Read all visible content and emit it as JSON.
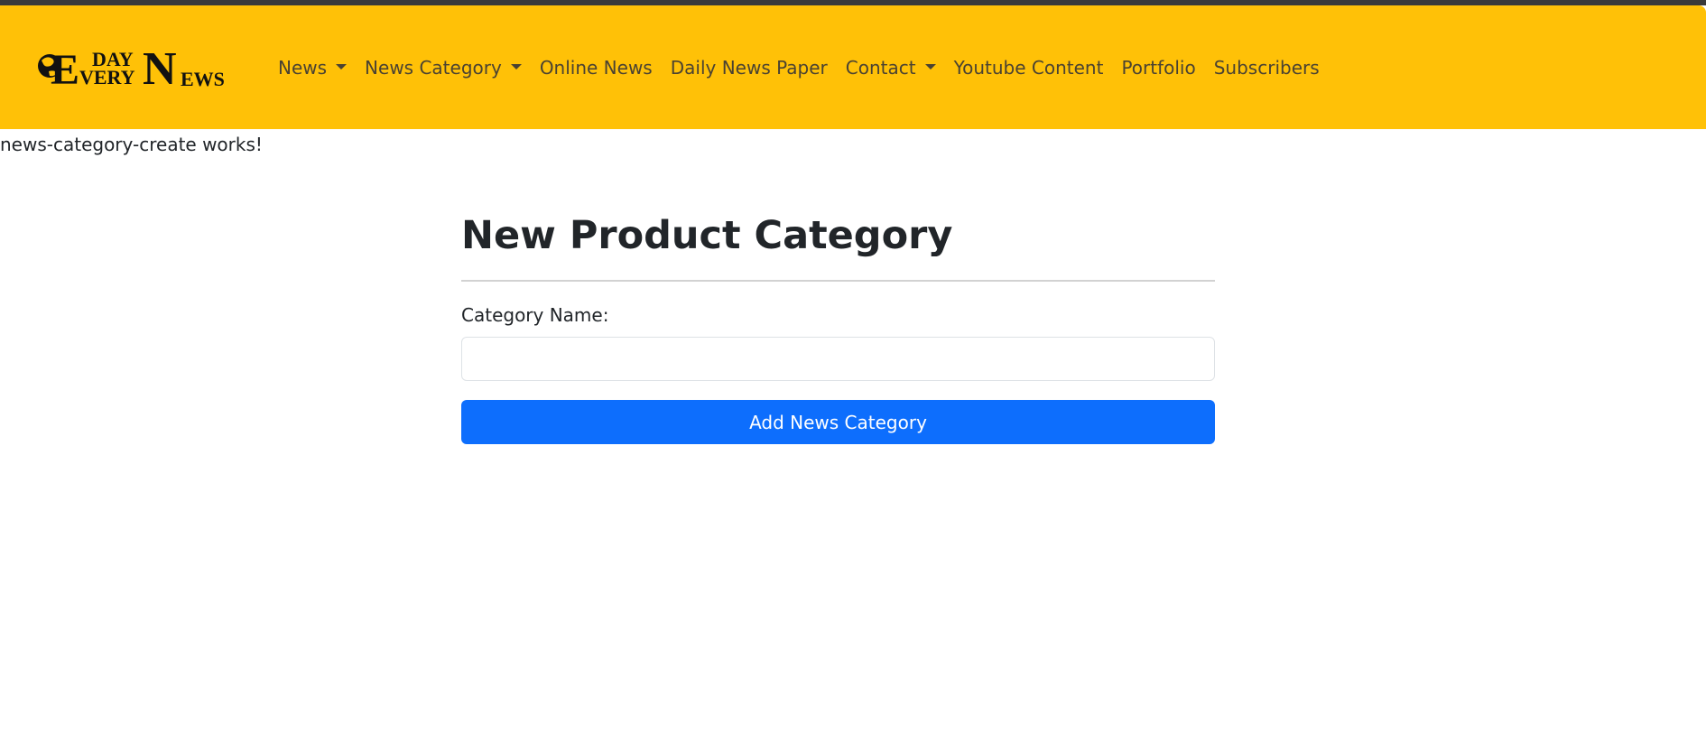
{
  "brand": {
    "logo_text": "EVERY DAY NEWS"
  },
  "nav": {
    "items": [
      {
        "label": "News",
        "dropdown": true
      },
      {
        "label": "News Category",
        "dropdown": true
      },
      {
        "label": "Online News",
        "dropdown": false
      },
      {
        "label": "Daily News Paper",
        "dropdown": false
      },
      {
        "label": "Contact",
        "dropdown": true
      },
      {
        "label": "Youtube Content",
        "dropdown": false
      },
      {
        "label": "Portfolio",
        "dropdown": false
      },
      {
        "label": "Subscribers",
        "dropdown": false
      }
    ]
  },
  "page": {
    "works_text": "news-category-create works!"
  },
  "form": {
    "title": "New Product Category",
    "category_label": "Category Name:",
    "category_value": "",
    "category_placeholder": "",
    "submit_label": "Add News Category"
  },
  "colors": {
    "navbar_bg": "#ffc107",
    "primary_button": "#0d6efd",
    "nav_text": "#4a4232"
  }
}
